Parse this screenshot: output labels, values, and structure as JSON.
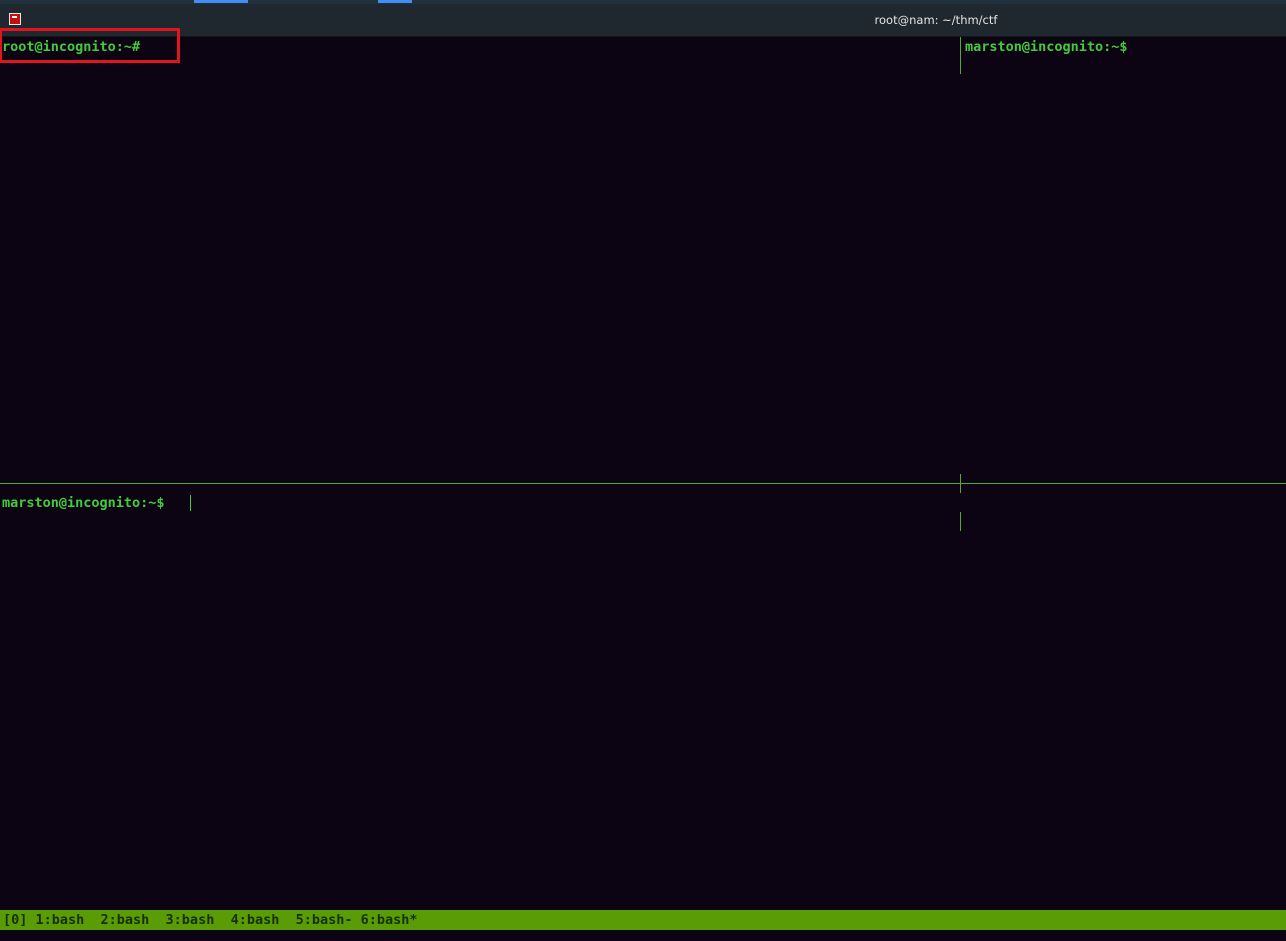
{
  "window": {
    "title": "root@nam: ~/thm/ctf"
  },
  "panes": {
    "top_left": {
      "prompt": "root@incognito:~#"
    },
    "top_right": {
      "prompt": "marston@incognito:~$"
    },
    "bottom_left": {
      "prompt": "marston@incognito:~$"
    }
  },
  "tmux": {
    "status": "[0] 1:bash  2:bash  3:bash  4:bash  5:bash- 6:bash*"
  },
  "colors": {
    "prompt": "#42cc3c",
    "background": "#0c0412",
    "status_bar": "#5a9c05",
    "highlight_box": "#e4141c"
  },
  "icons": {
    "app": "terminal-app-icon"
  }
}
